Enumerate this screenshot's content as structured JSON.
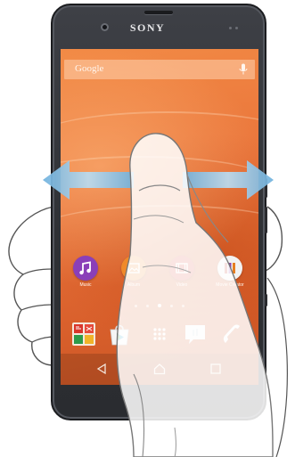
{
  "phone": {
    "brand": "SONY"
  },
  "search": {
    "label": "Google"
  },
  "apps": [
    {
      "label": "Music",
      "color": "#8a3fb8",
      "icon": "music-note-icon"
    },
    {
      "label": "Album",
      "color": "#f08a2a",
      "icon": "album-photo-icon"
    },
    {
      "label": "Video",
      "color": "#d84a3a",
      "icon": "video-film-icon"
    },
    {
      "label": "Movie Creator",
      "color": "#f2f2f2",
      "icon": "movie-creator-icon"
    }
  ],
  "page_indicator": {
    "count": 5,
    "active": 3
  },
  "dock": [
    {
      "name": "google-apps-folder",
      "icon": "app-folder-icon"
    },
    {
      "name": "play-store",
      "icon": "play-store-bag-icon"
    },
    {
      "name": "app-drawer",
      "icon": "app-drawer-grid-icon"
    },
    {
      "name": "messaging",
      "icon": "messaging-icon"
    },
    {
      "name": "phone",
      "icon": "phone-handset-icon"
    }
  ],
  "navigation": {
    "back": "back-icon",
    "home": "home-icon",
    "recent": "recent-apps-icon"
  },
  "gesture": {
    "type": "swipe",
    "direction": "left-right"
  },
  "colors": {
    "wallpaper": "#e9733a",
    "phone_body": "#34363a",
    "arrow": "#6aaad6"
  }
}
